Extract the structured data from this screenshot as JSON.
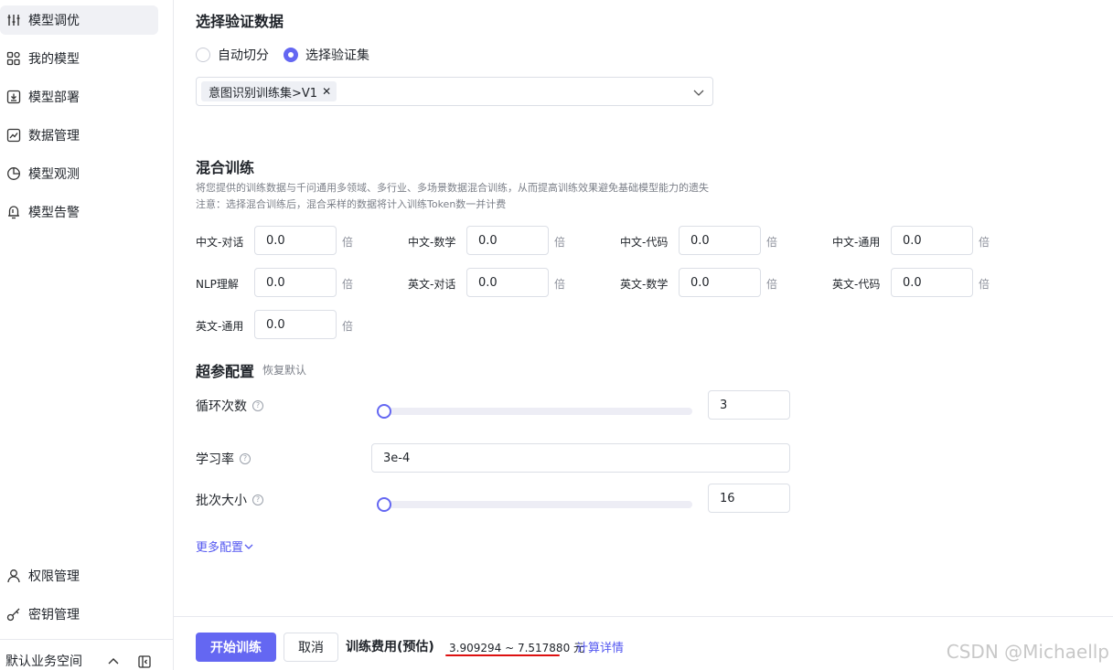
{
  "sidebar": {
    "items": [
      {
        "label": "模型调优",
        "icon": "sliders-icon",
        "active": true
      },
      {
        "label": "我的模型",
        "icon": "grid-icon"
      },
      {
        "label": "模型部署",
        "icon": "deploy-icon"
      },
      {
        "label": "数据管理",
        "icon": "chart-line-icon"
      },
      {
        "label": "模型观测",
        "icon": "pie-icon"
      },
      {
        "label": "模型告警",
        "icon": "bell-icon"
      }
    ],
    "bottom_items": [
      {
        "label": "权限管理",
        "icon": "user-icon"
      },
      {
        "label": "密钥管理",
        "icon": "key-icon"
      }
    ],
    "workspace": "默认业务空间"
  },
  "validation": {
    "title": "选择验证数据",
    "options": [
      "自动切分",
      "选择验证集"
    ],
    "selected_option": "选择验证集",
    "selected_tag": "意图识别训练集>V1"
  },
  "mix": {
    "title": "混合训练",
    "desc1": "将您提供的训练数据与千问通用多领域、多行业、多场景数据混合训练，从而提高训练效果避免基础模型能力的遗失",
    "desc2": "注意：选择混合训练后，混合采样的数据将计入训练Token数一并计费",
    "unit": "倍",
    "fields": [
      {
        "label": "中文-对话",
        "value": "0.0"
      },
      {
        "label": "中文-数学",
        "value": "0.0"
      },
      {
        "label": "中文-代码",
        "value": "0.0"
      },
      {
        "label": "中文-通用",
        "value": "0.0"
      },
      {
        "label": "NLP理解",
        "value": "0.0"
      },
      {
        "label": "英文-对话",
        "value": "0.0"
      },
      {
        "label": "英文-数学",
        "value": "0.0"
      },
      {
        "label": "英文-代码",
        "value": "0.0"
      },
      {
        "label": "英文-通用",
        "value": "0.0"
      }
    ]
  },
  "hyper": {
    "title": "超参配置",
    "reset": "恢复默认",
    "epochs": {
      "label": "循环次数",
      "value": "3",
      "slider_fraction": 0
    },
    "learning_rate": {
      "label": "学习率",
      "value": "3e-4"
    },
    "batch_size": {
      "label": "批次大小",
      "value": "16",
      "slider_fraction": 0
    },
    "more": "更多配置"
  },
  "footer": {
    "start": "开始训练",
    "cancel": "取消",
    "cost_label": "训练费用(预估)",
    "cost_value": "3.909294 ~ 7.517880 元",
    "cost_detail": "计算详情"
  },
  "watermark": "CSDN @Michaellp",
  "colors": {
    "accent": "#6467f2",
    "link": "#5458f0",
    "highlight": "#dd1111"
  }
}
